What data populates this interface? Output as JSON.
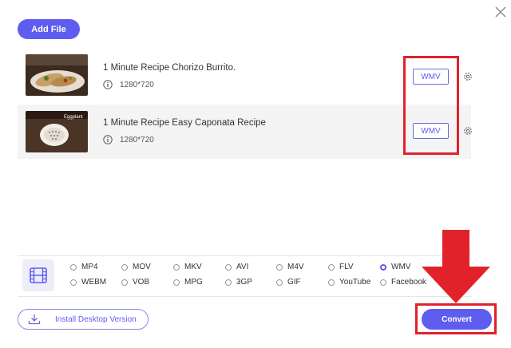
{
  "toolbar": {
    "add_file_label": "Add File"
  },
  "files": [
    {
      "title": "1 Minute Recipe Chorizo Burrito.",
      "resolution": "1280*720",
      "format": "WMV",
      "thumb_caption": ""
    },
    {
      "title": "1 Minute Recipe Easy Caponata Recipe",
      "resolution": "1280*720",
      "format": "WMV",
      "thumb_caption": "Eggplant"
    }
  ],
  "formats": {
    "row1": [
      "MP4",
      "MOV",
      "MKV",
      "AVI",
      "M4V",
      "FLV",
      "WMV"
    ],
    "row2": [
      "WEBM",
      "VOB",
      "MPG",
      "3GP",
      "GIF",
      "YouTube",
      "Facebook"
    ],
    "selected": "WMV"
  },
  "footer": {
    "install_label": "Install Desktop Version",
    "convert_label": "Convert"
  },
  "colors": {
    "accent": "#5f5df0",
    "highlight": "#e1222b"
  }
}
